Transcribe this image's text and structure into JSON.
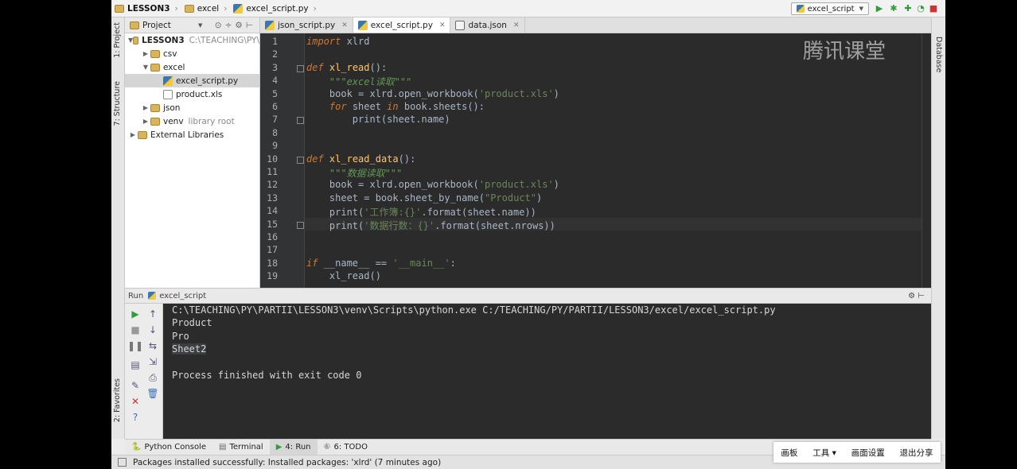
{
  "navbar": {
    "crumbs": [
      "LESSON3",
      "excel",
      "excel_script.py"
    ],
    "run_config": "excel_script",
    "run_config_arrow": "▼"
  },
  "stripe": {
    "project_tab": "1: Project",
    "structure_tab": "7: Structure",
    "favorites_tab": "2: Favorites",
    "database_tab": "Database"
  },
  "project": {
    "header": "Project",
    "header_arrow": "▼",
    "tree": [
      {
        "label": "LESSON3",
        "extra": "C:\\TEACHING\\PY\\",
        "icon": "folder",
        "depth": 0,
        "arrow": "▼",
        "bold": true
      },
      {
        "label": "csv",
        "icon": "folder",
        "depth": 1,
        "arrow": "▶"
      },
      {
        "label": "excel",
        "icon": "folder",
        "depth": 1,
        "arrow": "▼"
      },
      {
        "label": "excel_script.py",
        "icon": "py",
        "depth": 2,
        "arrow": "",
        "selected": true
      },
      {
        "label": "product.xls",
        "icon": "file",
        "depth": 2,
        "arrow": ""
      },
      {
        "label": "json",
        "icon": "folder",
        "depth": 1,
        "arrow": "▶"
      },
      {
        "label": "venv",
        "extra": "library root",
        "icon": "folder",
        "depth": 1,
        "arrow": "▶"
      },
      {
        "label": "External Libraries",
        "icon": "lib",
        "depth": 0,
        "arrow": "▶"
      }
    ]
  },
  "tabs": [
    {
      "label": "json_script.py",
      "icon": "py",
      "active": false
    },
    {
      "label": "excel_script.py",
      "icon": "py",
      "active": true
    },
    {
      "label": "data.json",
      "icon": "json",
      "active": false
    }
  ],
  "editor": {
    "watermark": "腾讯课堂",
    "lines": [
      {
        "n": "1",
        "html": "<span class='kw'>import</span> xlrd"
      },
      {
        "n": "2",
        "html": ""
      },
      {
        "n": "3",
        "html": "<span class='kw'>def</span> <span class='fn'>xl_read</span>():",
        "fold": true
      },
      {
        "n": "4",
        "html": "    <span class='doc'>\"\"\"excel读取\"\"\"</span>"
      },
      {
        "n": "5",
        "html": "    book = xlrd.open_workbook(<span class='str'>'product.xls'</span>)"
      },
      {
        "n": "6",
        "html": "    <span class='kw'>for</span> sheet <span class='kw'>in</span> book.sheets():"
      },
      {
        "n": "7",
        "html": "        print(sheet.name)",
        "fold": true
      },
      {
        "n": "8",
        "html": ""
      },
      {
        "n": "9",
        "html": ""
      },
      {
        "n": "10",
        "html": "<span class='kw'>def</span> <span class='fn'>xl_read_data</span>():",
        "fold": true
      },
      {
        "n": "11",
        "html": "    <span class='doc'>\"\"\"数据读取\"\"\"</span>"
      },
      {
        "n": "12",
        "html": "    book = xlrd.open_workbook(<span class='str'>'product.xls'</span>)"
      },
      {
        "n": "13",
        "html": "    sheet = book.sheet_by_name(<span class='str'>\"Product\"</span>)"
      },
      {
        "n": "14",
        "html": "    print(<span class='str'>'工作簿:{}'</span>.format(sheet.name))"
      },
      {
        "n": "15",
        "html": "    print(<span class='str'>'数据行数：{}'</span>.format(sheet.nrows))",
        "fold": true,
        "current": true
      },
      {
        "n": "16",
        "html": ""
      },
      {
        "n": "17",
        "html": ""
      },
      {
        "n": "18",
        "html": "<span class='kw'>if</span> __name__ == <span class='str'>'__main__'</span>:"
      },
      {
        "n": "19",
        "html": "    xl_read()"
      }
    ]
  },
  "run": {
    "header_label": "Run",
    "config": "excel_script",
    "output": [
      "C:\\TEACHING\\PY\\PARTII\\LESSON3\\venv\\Scripts\\python.exe C:/TEACHING/PY/PARTII/LESSON3/excel/excel_script.py",
      "Product",
      "Pro",
      "Sheet2",
      "",
      "Process finished with exit code 0"
    ]
  },
  "bottom_tabs": [
    {
      "label": "Python Console",
      "active": false
    },
    {
      "label": "Terminal",
      "active": false
    },
    {
      "label": "4: Run",
      "active": true
    },
    {
      "label": "6: TODO",
      "active": false
    }
  ],
  "status": {
    "message": "Packages installed successfully: Installed packages: 'xlrd' (7 minutes ago)"
  },
  "overlay": {
    "items": [
      "画板",
      "工具 ▾",
      "画面设置",
      "退出分享"
    ]
  }
}
